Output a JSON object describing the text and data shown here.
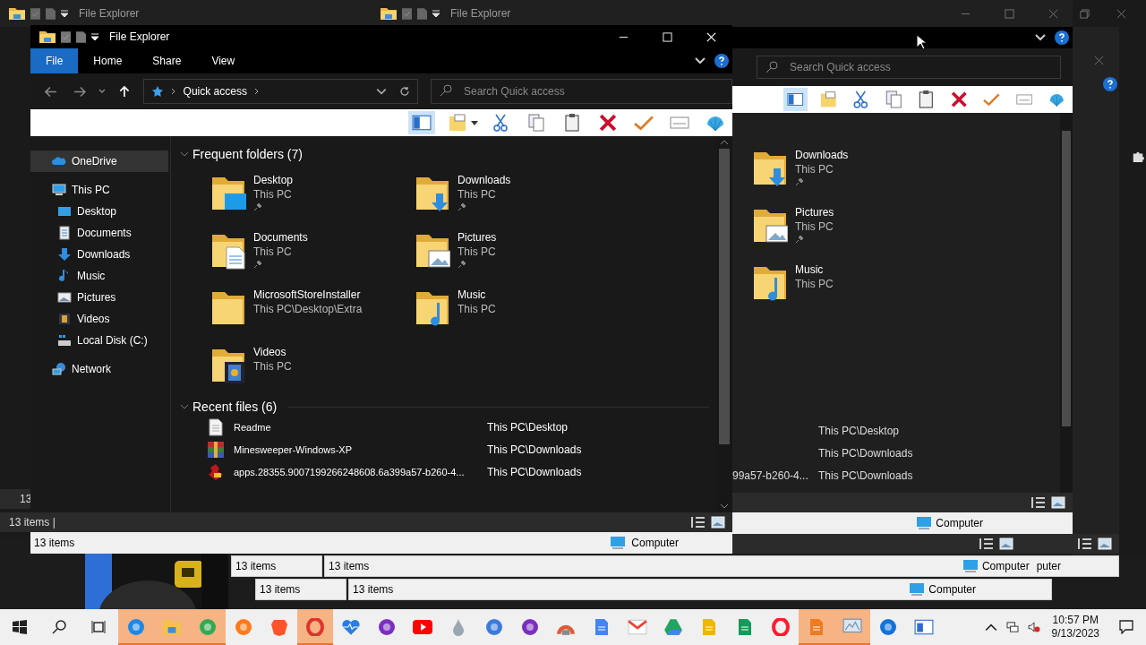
{
  "back_windows": [
    {
      "title": "File Explorer"
    },
    {
      "title": "File Explorer",
      "search": {
        "placeholder": "Search Quick access"
      },
      "folders": [
        {
          "name": "Downloads",
          "path": "This PC",
          "pinned": true,
          "kind": "downloads"
        },
        {
          "name": "Pictures",
          "path": "This PC",
          "pinned": true,
          "kind": "pictures"
        },
        {
          "name": "Music",
          "path": "This PC",
          "pinned": false,
          "kind": "music"
        }
      ],
      "recent": [
        {
          "path": "This PC\\Desktop"
        },
        {
          "path": "This PC\\Downloads"
        },
        {
          "name": "99a57-b260-4...",
          "path": "This PC\\Downloads"
        }
      ],
      "location": "Computer"
    }
  ],
  "left_status": {
    "count": "13",
    "items": "13 items |"
  },
  "front_window": {
    "title": "File Explorer",
    "tabs": [
      {
        "label": "File",
        "selected": true
      },
      {
        "label": "Home",
        "selected": false
      },
      {
        "label": "Share",
        "selected": false
      },
      {
        "label": "View",
        "selected": false
      }
    ],
    "address": "Quick access",
    "search": {
      "placeholder": "Search Quick access"
    },
    "sidebar": [
      {
        "label": "OneDrive",
        "kind": "cloud",
        "selected": true
      },
      {
        "label": "This PC",
        "kind": "pc",
        "selected": false,
        "children": [
          {
            "label": "Desktop",
            "kind": "desktop",
            "selected": false
          },
          {
            "label": "Documents",
            "kind": "documents",
            "selected": false
          },
          {
            "label": "Downloads",
            "kind": "downloads",
            "selected": false
          },
          {
            "label": "Music",
            "kind": "music",
            "selected": false
          },
          {
            "label": "Pictures",
            "kind": "pictures",
            "selected": false
          },
          {
            "label": "Videos",
            "kind": "videos",
            "selected": false
          },
          {
            "label": "Local Disk (C:)",
            "kind": "disk",
            "selected": false
          }
        ]
      },
      {
        "label": "Network",
        "kind": "network",
        "selected": false
      }
    ],
    "frequent_folders": {
      "title": "Frequent folders (7)",
      "expanded": true,
      "items": [
        {
          "name": "Desktop",
          "path": "This PC",
          "pinned": true,
          "kind": "desktop"
        },
        {
          "name": "Downloads",
          "path": "This PC",
          "pinned": true,
          "kind": "downloads"
        },
        {
          "name": "Documents",
          "path": "This PC",
          "pinned": true,
          "kind": "documents"
        },
        {
          "name": "Pictures",
          "path": "This PC",
          "pinned": true,
          "kind": "pictures"
        },
        {
          "name": "MicrosoftStoreInstaller",
          "path": "This PC\\Desktop\\Extra",
          "pinned": false,
          "kind": "plain"
        },
        {
          "name": "Music",
          "path": "This PC",
          "pinned": false,
          "kind": "music"
        },
        {
          "name": "Videos",
          "path": "This PC",
          "pinned": false,
          "kind": "videos"
        }
      ]
    },
    "recent_files": {
      "title": "Recent files (6)",
      "expanded": true,
      "items": [
        {
          "name": "Readme",
          "path": "This PC\\Desktop",
          "kind": "text"
        },
        {
          "name": "Minesweeper-Windows-XP",
          "path": "This PC\\Downloads",
          "kind": "archive"
        },
        {
          "name": "apps.28355.9007199266248608.6a399a57-b260-4...",
          "path": "This PC\\Downloads",
          "kind": "program"
        }
      ]
    },
    "status": {
      "items": "13 items",
      "location": "Computer"
    }
  },
  "status_strips": [
    {
      "items": [
        "13 items",
        "13 items"
      ],
      "locations": [
        "Computer",
        "puter"
      ]
    },
    {
      "items": [
        "13 items",
        "13 items"
      ],
      "locations": [
        "Computer"
      ]
    }
  ],
  "taskbar": {
    "apps": [
      {
        "kind": "edge",
        "running": true
      },
      {
        "kind": "explorer",
        "running": true
      },
      {
        "kind": "chrome",
        "running": true
      },
      {
        "kind": "firefox",
        "running": false
      },
      {
        "kind": "brave",
        "running": false
      },
      {
        "kind": "opera",
        "running": true
      },
      {
        "kind": "health",
        "running": false
      },
      {
        "kind": "mask",
        "running": false
      },
      {
        "kind": "youtube",
        "running": false
      },
      {
        "kind": "drop",
        "running": false
      },
      {
        "kind": "firefoxdev",
        "running": false
      },
      {
        "kind": "mask",
        "running": false
      },
      {
        "kind": "rainbow",
        "running": false
      },
      {
        "kind": "docs",
        "running": false
      },
      {
        "kind": "gmail",
        "running": false
      },
      {
        "kind": "drive",
        "running": false
      },
      {
        "kind": "slides",
        "running": false
      },
      {
        "kind": "sheets",
        "running": false
      },
      {
        "kind": "operagx",
        "running": false
      },
      {
        "kind": "pdf",
        "running": true
      },
      {
        "kind": "monitor",
        "running": true
      },
      {
        "kind": "thunderbird",
        "running": false
      },
      {
        "kind": "panel",
        "running": false
      }
    ],
    "time": "10:57 PM",
    "date": "9/13/2023"
  }
}
